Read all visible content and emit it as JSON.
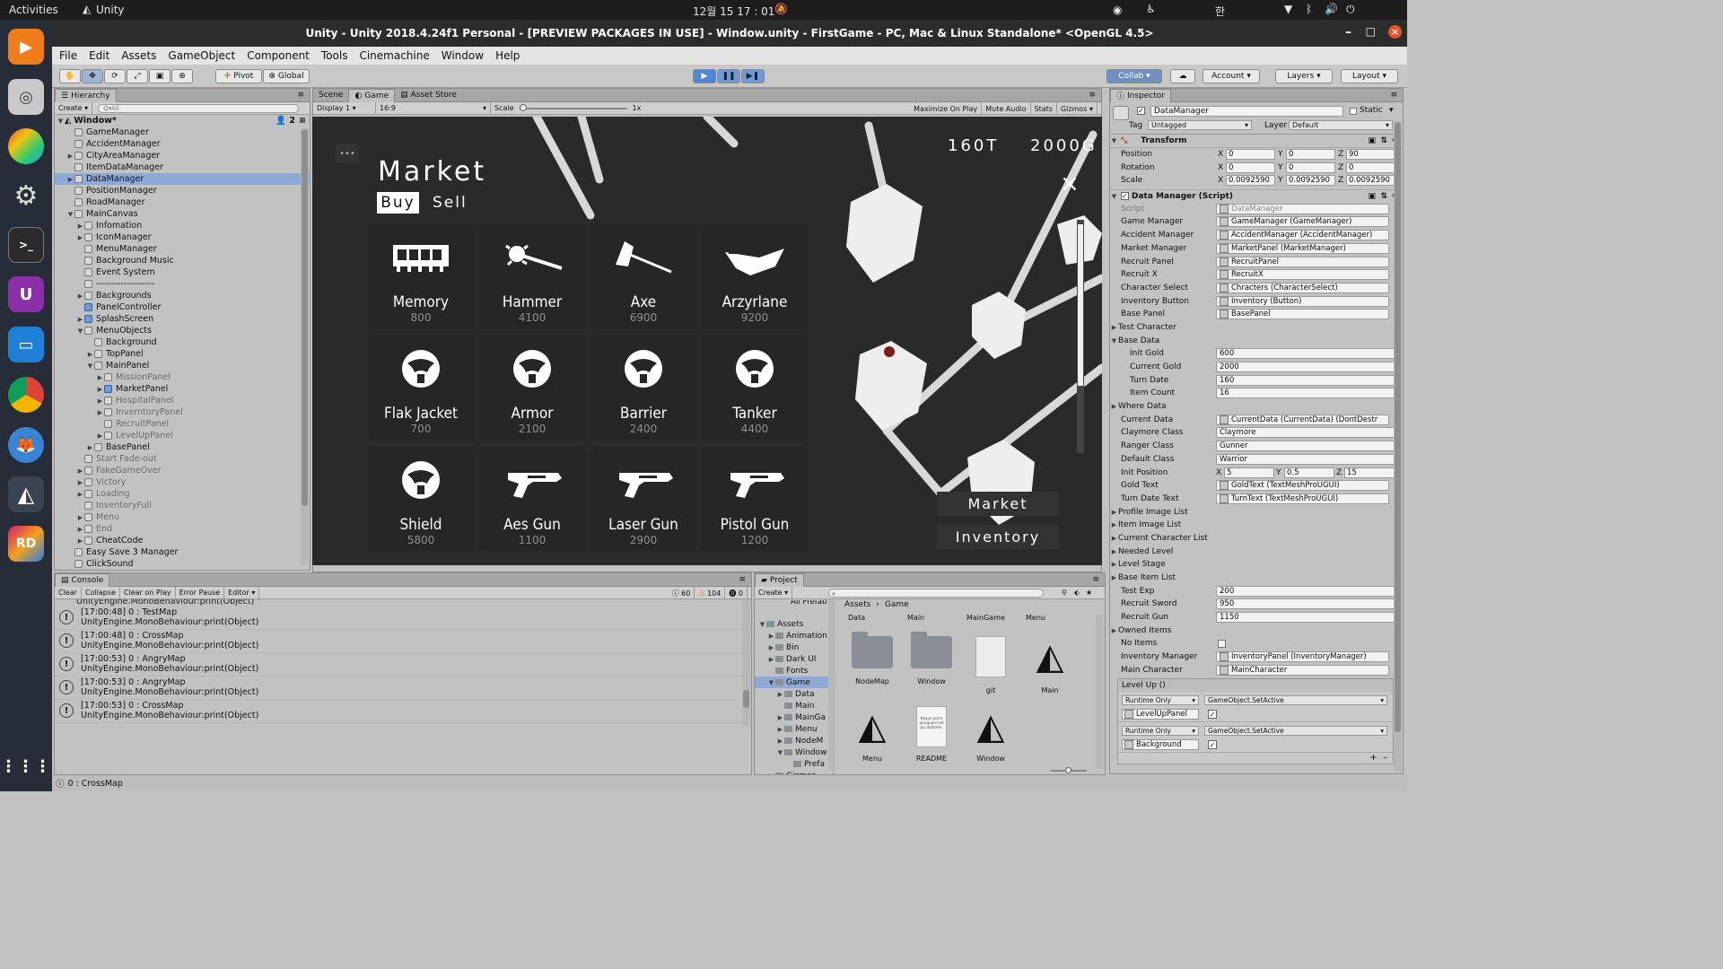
{
  "os_bar": {
    "activities": "Activities",
    "app_name": "Unity",
    "clock": "12월 15  17 : 01",
    "input_method": "한"
  },
  "window": {
    "title": "Unity - Unity 2018.4.24f1 Personal - [PREVIEW PACKAGES IN USE] - Window.unity - FirstGame - PC, Mac & Linux Standalone* <OpenGL 4.5>"
  },
  "menu": [
    "File",
    "Edit",
    "Assets",
    "GameObject",
    "Component",
    "Tools",
    "Cinemachine",
    "Window",
    "Help"
  ],
  "toolbar": {
    "pivot": "Pivot",
    "global": "Global",
    "collab": "Collab",
    "account": "Account",
    "layers": "Layers",
    "layout": "Layout"
  },
  "hierarchy": {
    "tab": "Hierarchy",
    "create": "Create",
    "search_placeholder": "Q▾All",
    "scene": "Window*",
    "badge": "2",
    "items": [
      {
        "name": "GameManager",
        "indent": 1,
        "fold": ""
      },
      {
        "name": "AccidentManager",
        "indent": 1,
        "fold": ""
      },
      {
        "name": "CityAreaManager",
        "indent": 1,
        "fold": "▶"
      },
      {
        "name": "ItemDataManager",
        "indent": 1,
        "fold": ""
      },
      {
        "name": "DataManager",
        "indent": 1,
        "fold": "▶",
        "selected": true
      },
      {
        "name": "PositionManager",
        "indent": 1,
        "fold": ""
      },
      {
        "name": "RoadManager",
        "indent": 1,
        "fold": ""
      },
      {
        "name": "MainCanvas",
        "indent": 1,
        "fold": "▼"
      },
      {
        "name": "Infomation",
        "indent": 2,
        "fold": "▶"
      },
      {
        "name": "IconManager",
        "indent": 2,
        "fold": "▶"
      },
      {
        "name": "MenuManager",
        "indent": 2,
        "fold": ""
      },
      {
        "name": "Background Music",
        "indent": 2,
        "fold": ""
      },
      {
        "name": "Event System",
        "indent": 2,
        "fold": ""
      },
      {
        "name": "-------------------",
        "indent": 2,
        "fold": ""
      },
      {
        "name": "Backgrounds",
        "indent": 2,
        "fold": "▶"
      },
      {
        "name": "PanelController",
        "indent": 2,
        "fold": "",
        "prefab": true
      },
      {
        "name": "SplashScreen",
        "indent": 2,
        "fold": "▶",
        "prefab": true
      },
      {
        "name": "MenuObjects",
        "indent": 2,
        "fold": "▼"
      },
      {
        "name": "Background",
        "indent": 3,
        "fold": ""
      },
      {
        "name": "TopPanel",
        "indent": 3,
        "fold": "▶"
      },
      {
        "name": "MainPanel",
        "indent": 3,
        "fold": "▼"
      },
      {
        "name": "MissionPanel",
        "indent": 4,
        "fold": "▶",
        "dim": true
      },
      {
        "name": "MarketPanel",
        "indent": 4,
        "fold": "▶",
        "prefab": true
      },
      {
        "name": "HospitalPanel",
        "indent": 4,
        "fold": "▶",
        "dim": true
      },
      {
        "name": "InverntoryPanel",
        "indent": 4,
        "fold": "▶",
        "dim": true
      },
      {
        "name": "RecruitPanel",
        "indent": 4,
        "fold": "",
        "dim": true
      },
      {
        "name": "LevelUpPanel",
        "indent": 4,
        "fold": "▶",
        "dim": true
      },
      {
        "name": "BasePanel",
        "indent": 3,
        "fold": "▶"
      },
      {
        "name": "Start Fade-out",
        "indent": 2,
        "fold": "",
        "dim": true
      },
      {
        "name": "FakeGameOver",
        "indent": 2,
        "fold": "▶",
        "dim": true
      },
      {
        "name": "Victory",
        "indent": 2,
        "fold": "▶",
        "dim": true
      },
      {
        "name": "Loading",
        "indent": 2,
        "fold": "▶",
        "dim": true
      },
      {
        "name": "InventoryFull",
        "indent": 2,
        "fold": "",
        "dim": true
      },
      {
        "name": "Menu",
        "indent": 2,
        "fold": "▶",
        "dim": true
      },
      {
        "name": "End",
        "indent": 2,
        "fold": "▶",
        "dim": true
      },
      {
        "name": "CheatCode",
        "indent": 2,
        "fold": "▶"
      },
      {
        "name": "Easy Save 3 Manager",
        "indent": 1,
        "fold": ""
      },
      {
        "name": "ClickSound",
        "indent": 1,
        "fold": ""
      }
    ]
  },
  "scene_tabs": {
    "scene": "Scene",
    "game": "Game",
    "store": "Asset Store"
  },
  "game_bar": {
    "display": "Display 1",
    "aspect": "16:9",
    "scale_label": "Scale",
    "scale_value": "1x",
    "maximize": "Maximize On Play",
    "mute": "Mute Audio",
    "stats": "Stats",
    "gizmos": "Gizmos"
  },
  "game": {
    "title": "Market",
    "tab_buy": "Buy",
    "tab_sell": "Sell",
    "turns": "160T",
    "gold": "2000G",
    "close": "×",
    "more": "•••",
    "button_market": "Market",
    "button_inventory": "Inventory",
    "items": [
      {
        "name": "Memory",
        "price": "800",
        "icon": "memory-icon"
      },
      {
        "name": "Hammer",
        "price": "4100",
        "icon": "hammer-icon"
      },
      {
        "name": "Axe",
        "price": "6900",
        "icon": "axe-icon"
      },
      {
        "name": "Arzyrlane",
        "price": "9200",
        "icon": "sword-icon"
      },
      {
        "name": "Flak Jacket",
        "price": "700",
        "icon": "armor-icon"
      },
      {
        "name": "Armor",
        "price": "2100",
        "icon": "armor-icon"
      },
      {
        "name": "Barrier",
        "price": "2400",
        "icon": "armor-icon"
      },
      {
        "name": "Tanker",
        "price": "4400",
        "icon": "armor-icon"
      },
      {
        "name": "Shield",
        "price": "5800",
        "icon": "armor-icon"
      },
      {
        "name": "Aes Gun",
        "price": "1100",
        "icon": "gun-icon"
      },
      {
        "name": "Laser Gun",
        "price": "2900",
        "icon": "gun-icon"
      },
      {
        "name": "Pistol Gun",
        "price": "1200",
        "icon": "gun-icon"
      }
    ]
  },
  "inspector": {
    "tab": "Inspector",
    "object_name": "DataManager",
    "static": "Static",
    "tag_label": "Tag",
    "tag": "Untagged",
    "layer_label": "Layer",
    "layer": "Default",
    "transform": {
      "title": "Transform",
      "position": {
        "label": "Position",
        "x": "0",
        "y": "0",
        "z": "90"
      },
      "rotation": {
        "label": "Rotation",
        "x": "0",
        "y": "0",
        "z": "0"
      },
      "scale": {
        "label": "Scale",
        "x": "0.0092590",
        "y": "0.0092590",
        "z": "0.0092590"
      }
    },
    "script_title": "Data Manager (Script)",
    "fields": [
      {
        "label": "Script",
        "value": "DataManager",
        "type": "obj",
        "dim": true
      },
      {
        "label": "Game Manager",
        "value": "GameManager (GameManager)",
        "type": "obj"
      },
      {
        "label": "Accident Manager",
        "value": "AccidentManager (AccidentManager)",
        "type": "obj"
      },
      {
        "label": "Market Manager",
        "value": "MarketPanel (MarketManager)",
        "type": "obj"
      },
      {
        "label": "Recruit Panel",
        "value": "RecruitPanel",
        "type": "obj"
      },
      {
        "label": "Recruit X",
        "value": "RecruitX",
        "type": "obj"
      },
      {
        "label": "Character Select",
        "value": "Chracters (CharacterSelect)",
        "type": "obj"
      },
      {
        "label": "Inventory Button",
        "value": "Inventory (Button)",
        "type": "obj"
      },
      {
        "label": "Base Panel",
        "value": "BasePanel",
        "type": "obj"
      },
      {
        "label": "Test Character",
        "value": "",
        "type": "fold"
      },
      {
        "label": "Base Data",
        "value": "",
        "type": "foldopen"
      },
      {
        "label": "Init Gold",
        "value": "600",
        "type": "text",
        "sub": true
      },
      {
        "label": "Current Gold",
        "value": "2000",
        "type": "text",
        "sub": true
      },
      {
        "label": "Turn Date",
        "value": "160",
        "type": "text",
        "sub": true
      },
      {
        "label": "Item Count",
        "value": "16",
        "type": "text",
        "sub": true
      },
      {
        "label": "Where Data",
        "value": "",
        "type": "fold"
      },
      {
        "label": "Current Data",
        "value": "CurrentData (CurrentData) (DontDestr",
        "type": "obj"
      },
      {
        "label": "Claymore Class",
        "value": "Claymore",
        "type": "text"
      },
      {
        "label": "Ranger Class",
        "value": "Gunner",
        "type": "text"
      },
      {
        "label": "Default Class",
        "value": "Warrior",
        "type": "text"
      },
      {
        "label": "Init Position",
        "value": "",
        "type": "vec",
        "x": "5",
        "y": "0.5",
        "z": "15"
      },
      {
        "label": "Gold Text",
        "value": "GoldText (TextMeshProUGUI)",
        "type": "obj"
      },
      {
        "label": "Turn Date Text",
        "value": "TurnText (TextMeshProUGUI)",
        "type": "obj"
      },
      {
        "label": "Profile Image List",
        "value": "",
        "type": "fold"
      },
      {
        "label": "Item Image List",
        "value": "",
        "type": "fold"
      },
      {
        "label": "Current Character List",
        "value": "",
        "type": "fold"
      },
      {
        "label": "Needed Level",
        "value": "",
        "type": "fold"
      },
      {
        "label": "Level Stage",
        "value": "",
        "type": "fold"
      },
      {
        "label": "Base Item List",
        "value": "",
        "type": "fold"
      },
      {
        "label": "Test Exp",
        "value": "200",
        "type": "text"
      },
      {
        "label": "Recruit Sword",
        "value": "950",
        "type": "text"
      },
      {
        "label": "Recruit Gun",
        "value": "1150",
        "type": "text"
      },
      {
        "label": "Owned Items",
        "value": "",
        "type": "fold"
      },
      {
        "label": "No Items",
        "value": "",
        "type": "check"
      },
      {
        "label": "Inventory Manager",
        "value": "InventoryPanel (InventoryManager)",
        "type": "obj"
      },
      {
        "label": "Main Character",
        "value": "MainCharacter",
        "type": "obj"
      }
    ],
    "event": {
      "title": "Level Up ()",
      "entries": [
        {
          "mode": "Runtime Only",
          "func": "GameObject.SetActive",
          "target": "LevelUpPanel"
        },
        {
          "mode": "Runtime Only",
          "func": "GameObject.SetActive",
          "target": "Background"
        }
      ]
    }
  },
  "console": {
    "tab": "Console",
    "buttons": [
      "Clear",
      "Collapse",
      "Clear on Play",
      "Error Pause",
      "Editor"
    ],
    "counts": {
      "info": "60",
      "warn": "104",
      "error": "0"
    },
    "clipped": "UnityEngine.MonoBehaviour:print(Object)",
    "logs": [
      {
        "line1": "[17:00:48] 0 : TestMap",
        "line2": "UnityEngine.MonoBehaviour:print(Object)"
      },
      {
        "line1": "[17:00:48] 0 : CrossMap",
        "line2": "UnityEngine.MonoBehaviour:print(Object)"
      },
      {
        "line1": "[17:00:53] 0 : AngryMap",
        "line2": "UnityEngine.MonoBehaviour:print(Object)"
      },
      {
        "line1": "[17:00:53] 0 : AngryMap",
        "line2": "UnityEngine.MonoBehaviour:print(Object)"
      },
      {
        "line1": "[17:00:53] 0 : CrossMap",
        "line2": "UnityEngine.MonoBehaviour:print(Object)"
      }
    ]
  },
  "project": {
    "tab": "Project",
    "create": "Create",
    "tree_top": "All Prefab",
    "tree": [
      {
        "name": "Assets",
        "indent": 0,
        "fold": "▼"
      },
      {
        "name": "Animation",
        "indent": 1,
        "fold": "▶"
      },
      {
        "name": "Bin",
        "indent": 1,
        "fold": "▶"
      },
      {
        "name": "Dark UI",
        "indent": 1,
        "fold": "▶"
      },
      {
        "name": "Fonts",
        "indent": 1,
        "fold": ""
      },
      {
        "name": "Game",
        "indent": 1,
        "fold": "▼",
        "selected": true
      },
      {
        "name": "Data",
        "indent": 2,
        "fold": "▶"
      },
      {
        "name": "Main",
        "indent": 2,
        "fold": ""
      },
      {
        "name": "MainGa",
        "indent": 2,
        "fold": "▶"
      },
      {
        "name": "Menu",
        "indent": 2,
        "fold": "▶"
      },
      {
        "name": "NodeM",
        "indent": 2,
        "fold": "▶"
      },
      {
        "name": "Window",
        "indent": 2,
        "fold": "▼"
      },
      {
        "name": "Prefa",
        "indent": 3,
        "fold": ""
      },
      {
        "name": "Gizmos",
        "indent": 1,
        "fold": "▶"
      }
    ],
    "breadcrumb": [
      "Assets",
      "Game"
    ],
    "top_labels": [
      "Data",
      "Main",
      "MainGame",
      "Menu"
    ],
    "assets_row1": [
      {
        "name": "NodeMap",
        "kind": "folder"
      },
      {
        "name": "Window",
        "kind": "folder"
      },
      {
        "name": "git",
        "kind": "file"
      },
      {
        "name": "Main",
        "kind": "unity"
      }
    ],
    "assets_row2": [
      {
        "name": "Menu",
        "kind": "unity"
      },
      {
        "name": "README",
        "kind": "doc"
      },
      {
        "name": "Window",
        "kind": "unity"
      }
    ],
    "readme_preview": "Neque porro quisquam est qui dolorem."
  },
  "status_bar": {
    "text": "0 : CrossMap"
  },
  "colors": {
    "dock": "#262d38",
    "accent": "#3d7ede",
    "selection": "#8fa9d6",
    "game_bg": "#2a2a2a"
  }
}
